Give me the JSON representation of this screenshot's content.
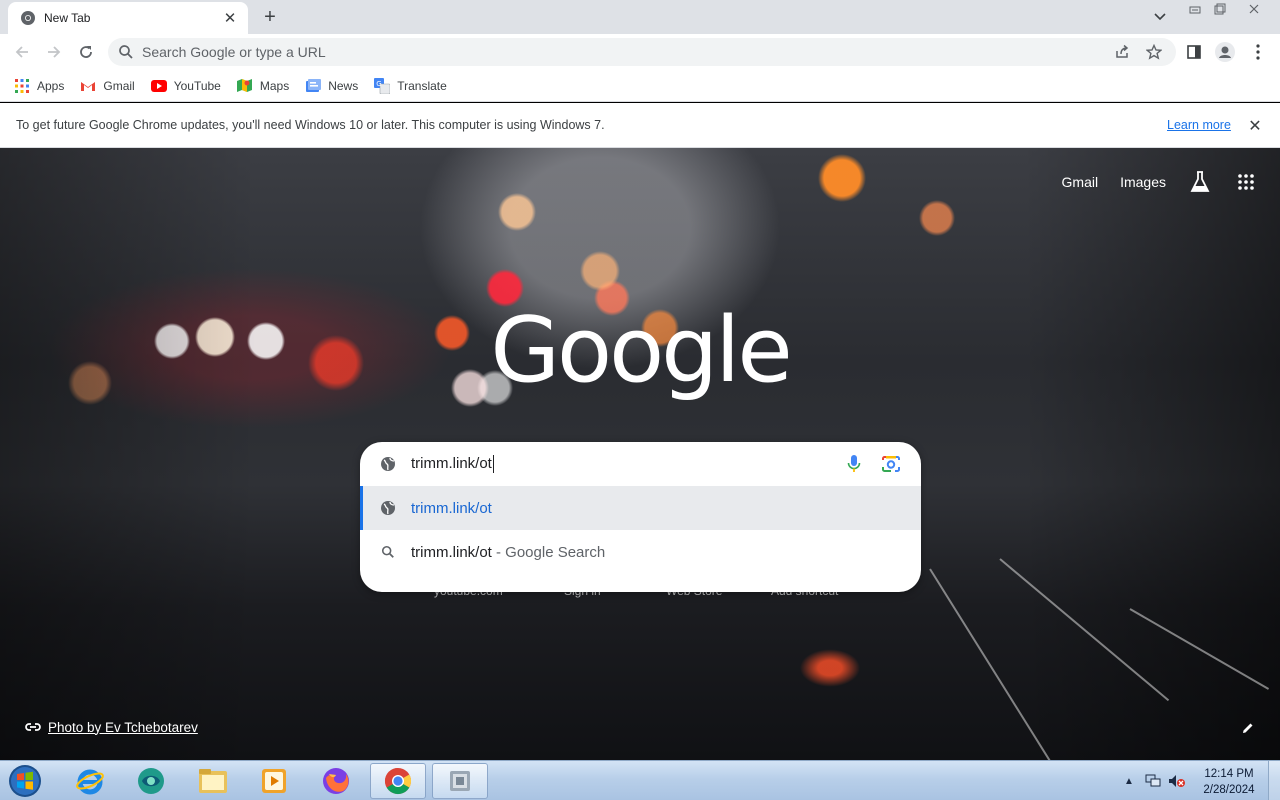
{
  "browser": {
    "tab": {
      "title": "New Tab"
    },
    "omnibox": {
      "placeholder": "Search Google or type a URL"
    },
    "bookmarks": [
      {
        "label": "Apps",
        "icon": "apps-grid-icon"
      },
      {
        "label": "Gmail",
        "icon": "gmail-icon"
      },
      {
        "label": "YouTube",
        "icon": "youtube-icon"
      },
      {
        "label": "Maps",
        "icon": "maps-icon"
      },
      {
        "label": "News",
        "icon": "news-icon"
      },
      {
        "label": "Translate",
        "icon": "translate-icon"
      }
    ],
    "infobar": {
      "message": "To get future Google Chrome updates, you'll need Windows 10 or later. This computer is using Windows 7.",
      "link": "Learn more"
    }
  },
  "ntp": {
    "top_links": {
      "gmail": "Gmail",
      "images": "Images"
    },
    "logo": "Google",
    "search": {
      "input_value": "trimm.link/ot",
      "suggestions": [
        {
          "text": "trimm.link/ot",
          "type": "url"
        },
        {
          "text": "trimm.link/ot",
          "suffix": " - Google Search",
          "type": "search"
        }
      ]
    },
    "shortcuts": [
      "youtube.com",
      "Sign in",
      "Web Store",
      "Add shortcut"
    ],
    "photo_credit": "Photo by Ev Tchebotarev"
  },
  "taskbar": {
    "apps": [
      "internet-explorer",
      "unknown-app",
      "file-explorer",
      "media-player",
      "firefox",
      "chrome",
      "generic-app"
    ],
    "clock": {
      "time": "12:14 PM",
      "date": "2/28/2024"
    }
  },
  "colors": {
    "accent": "#1a73e8",
    "suggestion_highlight": "#e8eaed",
    "tabstrip": "#dee1e6"
  }
}
